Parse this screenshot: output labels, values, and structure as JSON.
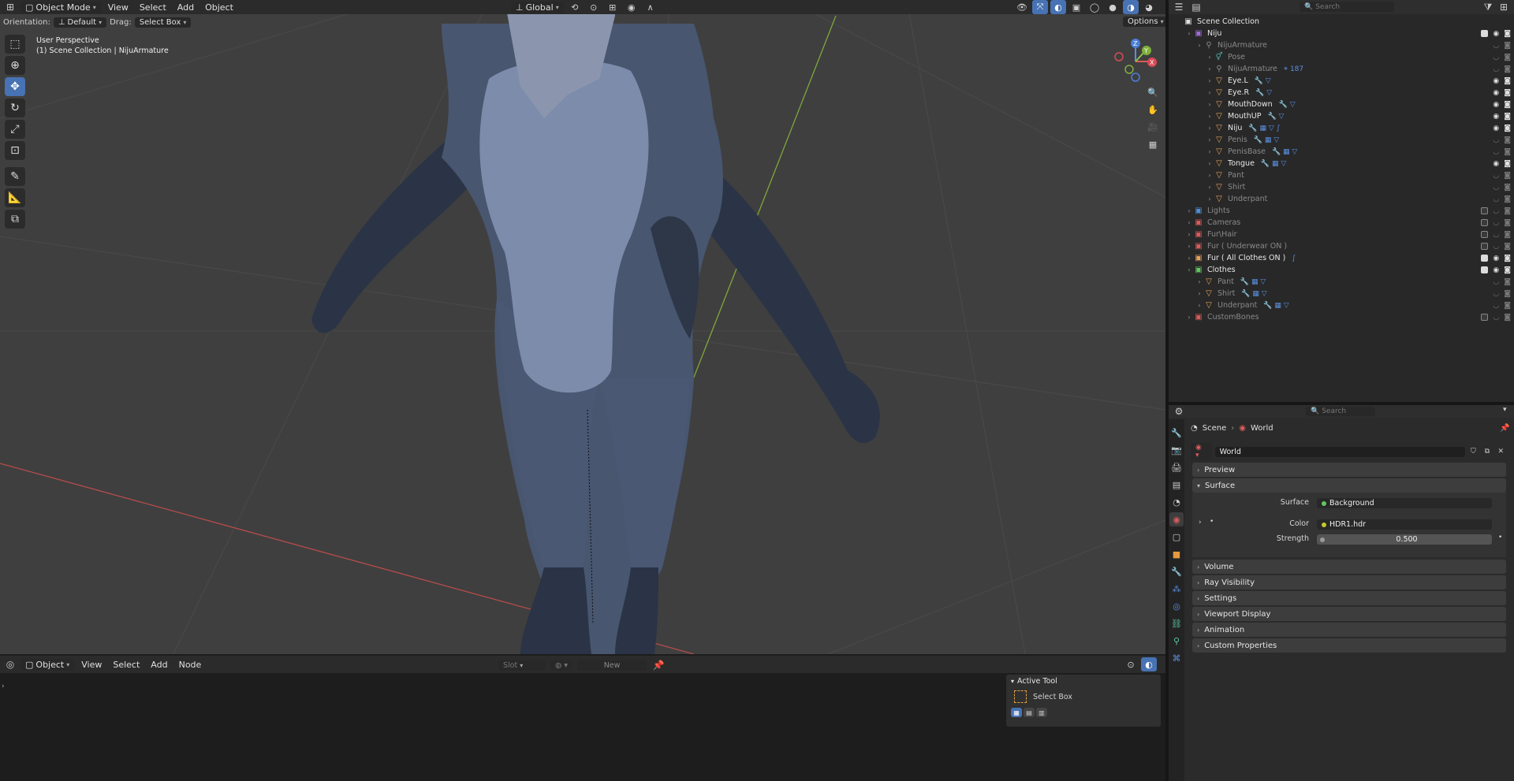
{
  "viewport_header": {
    "mode": "Object Mode",
    "menus": [
      "View",
      "Select",
      "Add",
      "Object"
    ],
    "transform": "Global",
    "options": "Options"
  },
  "tool_settings": {
    "orientation_label": "Orientation:",
    "orientation_value": "Default",
    "drag_label": "Drag:",
    "drag_value": "Select Box"
  },
  "viewport_info": {
    "line1": "User Perspective",
    "line2": "(1) Scene Collection | NijuArmature"
  },
  "gizmo": {
    "x": "X",
    "y": "Y",
    "z": "Z"
  },
  "outliner": {
    "search_placeholder": "Search",
    "rows": [
      {
        "label": "Scene Collection",
        "indent": 0,
        "icon": "collection",
        "color": "#e0e0e0",
        "dim": false
      },
      {
        "label": "Niju",
        "indent": 1,
        "icon": "collection",
        "color": "#9b6bd6",
        "dim": false,
        "check": true,
        "vis": true
      },
      {
        "label": "NijuArmature",
        "indent": 2,
        "icon": "armature",
        "color": "#8a8a8a",
        "dim": true
      },
      {
        "label": "Pose",
        "indent": 3,
        "icon": "pose",
        "color": "#4fa9a0",
        "dim": true
      },
      {
        "label": "NijuArmature",
        "indent": 3,
        "icon": "armature",
        "color": "#8a8a8a",
        "dim": true,
        "mods": "⌖ 187"
      },
      {
        "label": "Eye.L",
        "indent": 3,
        "icon": "mesh",
        "color": "#e5a15a",
        "dim": false,
        "mods": "🔧 ▽",
        "vis": true
      },
      {
        "label": "Eye.R",
        "indent": 3,
        "icon": "mesh",
        "color": "#e5a15a",
        "dim": false,
        "mods": "🔧 ▽",
        "vis": true
      },
      {
        "label": "MouthDown",
        "indent": 3,
        "icon": "mesh",
        "color": "#e5a15a",
        "dim": false,
        "mods": "🔧 ▽",
        "vis": true
      },
      {
        "label": "MouthUP",
        "indent": 3,
        "icon": "mesh",
        "color": "#e5a15a",
        "dim": false,
        "mods": "🔧 ▽",
        "vis": true
      },
      {
        "label": "Niju",
        "indent": 3,
        "icon": "mesh",
        "color": "#e5a15a",
        "dim": false,
        "mods": "🔧 ▦ ▽ ∫",
        "vis": true
      },
      {
        "label": "Penis",
        "indent": 3,
        "icon": "mesh",
        "color": "#e5a15a",
        "dim": true,
        "mods": "🔧 ▦ ▽"
      },
      {
        "label": "PenisBase",
        "indent": 3,
        "icon": "mesh",
        "color": "#e5a15a",
        "dim": true,
        "mods": "🔧 ▦ ▽"
      },
      {
        "label": "Tongue",
        "indent": 3,
        "icon": "mesh",
        "color": "#e5a15a",
        "dim": false,
        "mods": "🔧 ▦ ▽",
        "vis": true
      },
      {
        "label": "Pant",
        "indent": 3,
        "icon": "mesh",
        "color": "#e5a15a",
        "dim": true
      },
      {
        "label": "Shirt",
        "indent": 3,
        "icon": "mesh",
        "color": "#e5a15a",
        "dim": true
      },
      {
        "label": "Underpant",
        "indent": 3,
        "icon": "mesh",
        "color": "#e5a15a",
        "dim": true
      },
      {
        "label": "Lights",
        "indent": 1,
        "icon": "collection",
        "color": "#4a8fd8",
        "dim": true,
        "check": false
      },
      {
        "label": "Cameras",
        "indent": 1,
        "icon": "collection",
        "color": "#d85a5a",
        "dim": true,
        "check": false
      },
      {
        "label": "Fur\\Hair",
        "indent": 1,
        "icon": "collection",
        "color": "#d85a5a",
        "dim": true,
        "check": false
      },
      {
        "label": "Fur ( Underwear ON )",
        "indent": 1,
        "icon": "collection",
        "color": "#d85a5a",
        "dim": true,
        "check": false
      },
      {
        "label": "Fur ( All Clothes ON )",
        "indent": 1,
        "icon": "collection",
        "color": "#e5a15a",
        "dim": false,
        "check": true,
        "vis": true,
        "mods": "∫"
      },
      {
        "label": "Clothes",
        "indent": 1,
        "icon": "collection",
        "color": "#5fc95f",
        "dim": false,
        "check": true,
        "vis": true
      },
      {
        "label": "Pant",
        "indent": 2,
        "icon": "mesh",
        "color": "#e5a15a",
        "dim": true,
        "mods": "🔧 ▦ ▽"
      },
      {
        "label": "Shirt",
        "indent": 2,
        "icon": "mesh",
        "color": "#e5a15a",
        "dim": true,
        "mods": "🔧 ▦ ▽"
      },
      {
        "label": "Underpant",
        "indent": 2,
        "icon": "mesh",
        "color": "#e5a15a",
        "dim": true,
        "mods": "🔧 ▦ ▽"
      },
      {
        "label": "CustomBones",
        "indent": 1,
        "icon": "collection",
        "color": "#d85a5a",
        "dim": true,
        "check": false
      }
    ]
  },
  "properties": {
    "search_placeholder": "Search",
    "breadcrumb_scene": "Scene",
    "breadcrumb_world": "World",
    "datablock": "World",
    "panels": {
      "preview": "Preview",
      "surface": "Surface",
      "volume": "Volume",
      "ray_visibility": "Ray Visibility",
      "settings": "Settings",
      "viewport_display": "Viewport Display",
      "animation": "Animation",
      "custom_properties": "Custom Properties"
    },
    "surface_label": "Surface",
    "surface_value": "Background",
    "color_label": "Color",
    "color_value": "HDR1.hdr",
    "strength_label": "Strength",
    "strength_value": "0.500"
  },
  "node_editor": {
    "type": "Object",
    "menus": [
      "View",
      "Select",
      "Add",
      "Node"
    ],
    "slot": "Slot",
    "new_button": "New"
  },
  "active_tool": {
    "title": "Active Tool",
    "tool_name": "Select Box"
  }
}
